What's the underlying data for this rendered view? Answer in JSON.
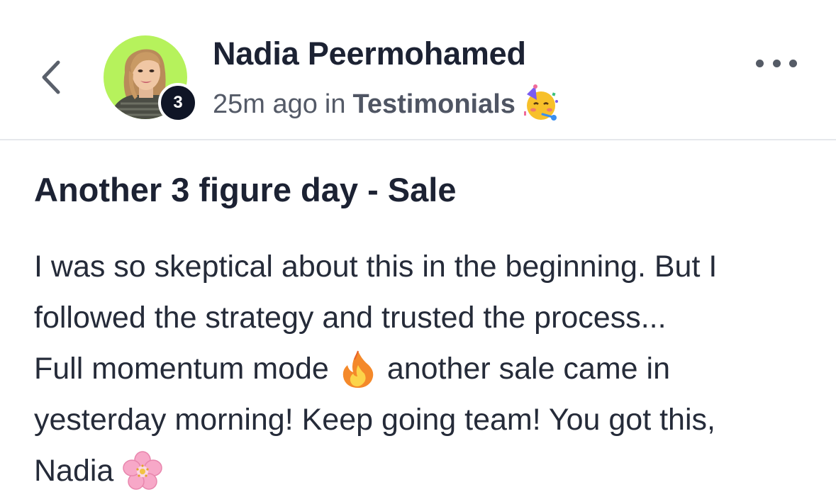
{
  "header": {
    "author_name": "Nadia Peermohamed",
    "level": "3",
    "time_ago": "25m ago",
    "in_word": "in",
    "category": "Testimonials",
    "category_emoji": "partying-face-icon"
  },
  "post": {
    "title": "Another 3 figure day - Sale",
    "body_lines": [
      "I was so skeptical about this in the beginning. But I",
      "followed the strategy and trusted the process...",
      "Full momentum mode",
      "another sale came in",
      "yesterday morning! Keep going team! You got this,",
      "Nadia"
    ],
    "emojis": [
      "fire-icon",
      "cherry-blossom-icon"
    ]
  },
  "colors": {
    "avatar_bg": "#b6f25c",
    "badge_bg": "#0f1526",
    "text_primary": "#1c2233",
    "text_secondary": "#545a67",
    "divider": "#e6e8ec"
  }
}
